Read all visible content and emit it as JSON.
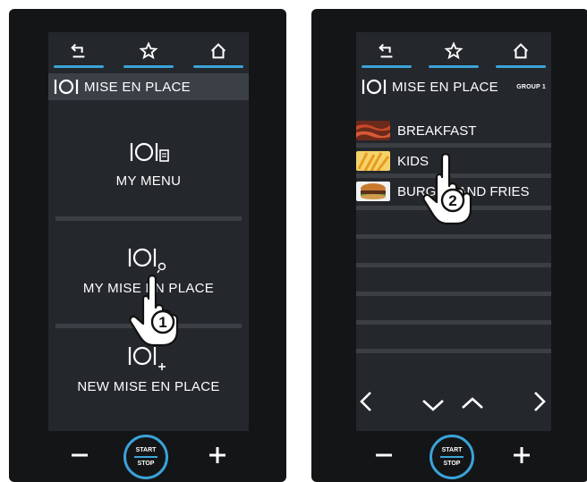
{
  "panel1": {
    "header": {
      "title": "MISE EN PLACE"
    },
    "items": [
      {
        "label": "MY MENU"
      },
      {
        "label": "MY MISE EN PLACE"
      },
      {
        "label": "NEW MISE EN PLACE"
      }
    ],
    "callout": "1"
  },
  "panel2": {
    "header": {
      "title": "MISE EN PLACE",
      "group": "GROUP 1"
    },
    "items": [
      {
        "label": "BREAKFAST",
        "thumb": "bacon"
      },
      {
        "label": "KIDS",
        "thumb": "fries"
      },
      {
        "label": "BURGER AND FRIES",
        "thumb": "burger"
      }
    ],
    "callout": "2"
  },
  "controls": {
    "start": "START",
    "stop": "STOP"
  },
  "icons": [
    "back-icon",
    "star-icon",
    "home-icon",
    "mise-en-place-icon",
    "chevron-left-icon",
    "chevron-right-icon",
    "chevron-down-icon",
    "chevron-up-icon",
    "minus-icon",
    "plus-icon",
    "pointing-hand-icon"
  ],
  "colors": {
    "accent": "#3aa3d8",
    "device": "#141517",
    "screen": "#24272b",
    "header": "#3b4046"
  }
}
